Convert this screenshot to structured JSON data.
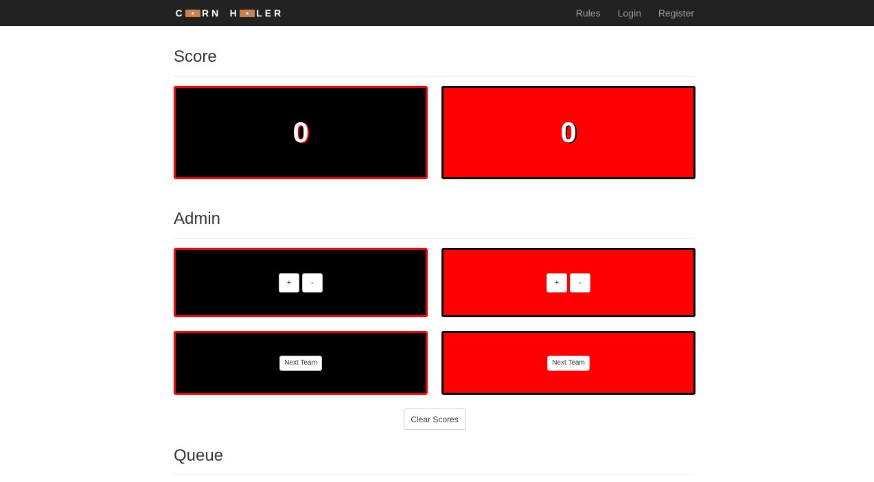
{
  "navbar": {
    "brand": {
      "part1_start": "C",
      "part1_end": "RN",
      "part2_start": "H",
      "part2_end": "LER"
    },
    "links": [
      "Rules",
      "Login",
      "Register"
    ]
  },
  "sections": {
    "score": "Score",
    "admin": "Admin",
    "queue": "Queue"
  },
  "teams": [
    {
      "color": "black",
      "score": "0",
      "plus_label": "+",
      "minus_label": "-",
      "next_label": "Next Team"
    },
    {
      "color": "red",
      "score": "0",
      "plus_label": "+",
      "minus_label": "-",
      "next_label": "Next Team"
    }
  ],
  "clear_scores_label": "Clear Scores",
  "colors": {
    "navbar_bg": "#222222",
    "nav_link": "#9d9d9d",
    "team_black": "#000000",
    "team_red": "#ff0000",
    "board": "#c48355"
  },
  "icons": {
    "brand_board": "cornhole-board-icon"
  }
}
